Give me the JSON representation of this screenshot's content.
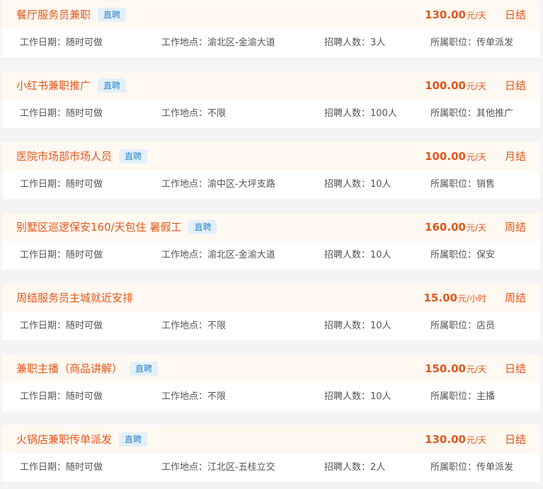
{
  "labels": {
    "work_date": "工作日期：",
    "work_location": "工作地点：",
    "recruit_count": "招聘人数：",
    "position": "所属职位："
  },
  "jobs": [
    {
      "title": "餐厅服务员兼职",
      "badge": "直聘",
      "salary_amount": "130.00",
      "salary_unit": "元/天",
      "settlement": "日结",
      "work_date": "随时可做",
      "work_location": "渝北区-金渝大道",
      "recruit_count": "3人",
      "position": "传单派发"
    },
    {
      "title": "小红书兼职推广",
      "badge": "直聘",
      "salary_amount": "100.00",
      "salary_unit": "元/天",
      "settlement": "日结",
      "work_date": "随时可做",
      "work_location": "不限",
      "recruit_count": "100人",
      "position": "其他推广"
    },
    {
      "title": "医院市场部市场人员",
      "badge": "直聘",
      "salary_amount": "100.00",
      "salary_unit": "元/天",
      "settlement": "月结",
      "work_date": "随时可做",
      "work_location": "渝中区-大坪支路",
      "recruit_count": "10人",
      "position": "销售"
    },
    {
      "title": "别墅区巡逻保安160/天包住 暑假工",
      "badge": "直聘",
      "salary_amount": "160.00",
      "salary_unit": "元/天",
      "settlement": "周结",
      "work_date": "随时可做",
      "work_location": "渝北区-金渝大道",
      "recruit_count": "10人",
      "position": "保安"
    },
    {
      "title": "周结服务员主城就近安排",
      "badge": "",
      "salary_amount": "15.00",
      "salary_unit": "元/小时",
      "settlement": "周结",
      "work_date": "随时可做",
      "work_location": "不限",
      "recruit_count": "10人",
      "position": "店员"
    },
    {
      "title": "兼职主播（商品讲解）",
      "badge": "直聘",
      "salary_amount": "150.00",
      "salary_unit": "元/天",
      "settlement": "日结",
      "work_date": "随时可做",
      "work_location": "不限",
      "recruit_count": "10人",
      "position": "主播"
    },
    {
      "title": "火锅店兼职传单派发",
      "badge": "直聘",
      "salary_amount": "130.00",
      "salary_unit": "元/天",
      "settlement": "日结",
      "work_date": "随时可做",
      "work_location": "江北区-五桂立交",
      "recruit_count": "2人",
      "position": "传单派发"
    }
  ]
}
